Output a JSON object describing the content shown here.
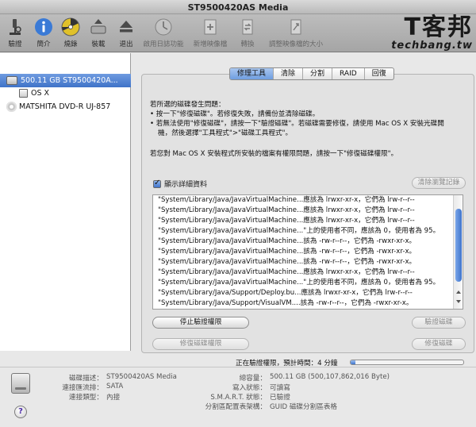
{
  "window": {
    "title": "ST9500420AS Media"
  },
  "toolbar": {
    "items": [
      {
        "label": "驗證",
        "icon": "microscope-icon",
        "enabled": true
      },
      {
        "label": "簡介",
        "icon": "info-icon",
        "enabled": true
      },
      {
        "label": "燒錄",
        "icon": "burn-icon",
        "enabled": true
      },
      {
        "label": "裝載",
        "icon": "mount-icon",
        "enabled": true
      },
      {
        "label": "退出",
        "icon": "eject-icon",
        "enabled": true
      },
      {
        "label": "啟用日誌功能",
        "icon": "journal-icon",
        "enabled": false
      },
      {
        "label": "新增映像檔",
        "icon": "new-image-icon",
        "enabled": false
      },
      {
        "label": "轉換",
        "icon": "convert-icon",
        "enabled": false
      },
      {
        "label": "調整映像檔的大小",
        "icon": "resize-image-icon",
        "enabled": false
      }
    ],
    "watermark_cn": "T客邦",
    "watermark_en": "techbang.tw"
  },
  "sidebar": {
    "items": [
      {
        "label": "500.11 GB ST9500420A...",
        "icon": "hard-disk-icon",
        "selected": true,
        "indent": 0
      },
      {
        "label": "OS X",
        "icon": "volume-icon",
        "selected": false,
        "indent": 1
      },
      {
        "label": "MATSHITA DVD-R UJ-857",
        "icon": "dvd-icon",
        "selected": false,
        "indent": 0
      }
    ]
  },
  "tabs": [
    "修理工具",
    "清除",
    "分割",
    "RAID",
    "回復"
  ],
  "active_tab": 0,
  "help": {
    "line1": "若所選的磁碟發生問題：",
    "line2": "• 按一下\"修復磁碟\"。若修復失敗，請備份並清除磁碟。",
    "line3": "• 若無法使用\"修復磁碟\"，請按一下\"驗證磁碟\"。若磁碟需要修復，請使用 Mac OS X 安裝光碟開",
    "line4": "  機，然後選擇\"工具程式\">\"磁碟工具程式\"。",
    "line5": "若您對 Mac OS X 安裝程式所安裝的檔案有權限問題，請按一下\"修復磁碟權限\"。"
  },
  "details": {
    "checkbox_label": "顯示詳細資料",
    "checked": true,
    "clear_history_label": "清除瀏覽記錄"
  },
  "log": {
    "lines": [
      "\"System/Library/Java/JavaVirtualMachine...應該為 lrwxr-xr-x，它們為 lrw-r--r--",
      "\"System/Library/Java/JavaVirtualMachine...應該為 lrwxr-xr-x，它們為 lrw-r--r--",
      "\"System/Library/Java/JavaVirtualMachine...應該為 lrwxr-xr-x，它們為 lrw-r--r--",
      "\"System/Library/Java/JavaVirtualMachine...\"上的使用者不同，應該為 0，使用者為 95。",
      "\"System/Library/Java/JavaVirtualMachine...該為 -rw-r--r--，它們為 -rwxr-xr-x。",
      "\"System/Library/Java/JavaVirtualMachine...該為 -rw-r--r--，它們為 -rwxr-xr-x。",
      "\"System/Library/Java/JavaVirtualMachine...該為 -rw-r--r--，它們為 -rwxr-xr-x。",
      "\"System/Library/Java/JavaVirtualMachine...應該為 lrwxr-xr-x，它們為 lrw-r--r--",
      "\"System/Library/Java/JavaVirtualMachine...\"上的使用者不同，應該為 0，使用者為 95。",
      "\"System/Library/Java/Support/Deploy.bu...應該為 lrwxr-xr-x，它們為 lrw-r--r--",
      "\"System/Library/Java/Support/VisualVM....該為 -rw-r--r--，它們為 -rwxr-xr-x。"
    ],
    "scroll_fraction": 0.64
  },
  "buttons": {
    "stop_verify": "停止驗證權限",
    "verify_disk": "驗證磁碟",
    "repair_permissions": "修復磁碟權限",
    "repair_disk": "修復磁碟"
  },
  "progress": {
    "text": "正在驗證權限，預計時間：4 分鐘",
    "fraction": 0.04
  },
  "info": {
    "left": [
      {
        "label": "磁碟描述：",
        "value": "ST9500420AS Media"
      },
      {
        "label": "連接匯流排：",
        "value": "SATA"
      },
      {
        "label": "連接類型：",
        "value": "內接"
      }
    ],
    "right": [
      {
        "label": "總容量：",
        "value": "500.11 GB (500,107,862,016 Byte)"
      },
      {
        "label": "寫入狀態：",
        "value": "可讀寫"
      },
      {
        "label": "S.M.A.R.T. 狀態：",
        "value": "已驗證"
      },
      {
        "label": "分割區配置表架構：",
        "value": "GUID 磁碟分割區表格"
      }
    ]
  },
  "help_button": "?"
}
